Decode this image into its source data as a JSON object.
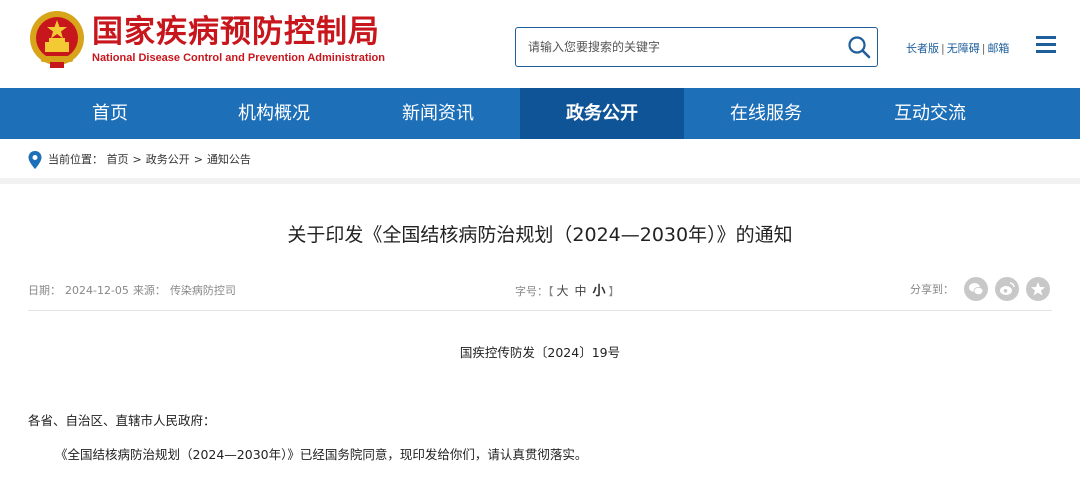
{
  "header": {
    "site_title": "国家疾病预防控制局",
    "site_subtitle": "National Disease Control and Prevention Administration",
    "search_placeholder": "请输入您要搜索的关键字",
    "links": [
      "长者版",
      "无障碍",
      "邮箱"
    ]
  },
  "nav": {
    "items": [
      "首页",
      "机构概况",
      "新闻资讯",
      "政务公开",
      "在线服务",
      "互动交流"
    ],
    "active": "政务公开"
  },
  "breadcrumb": {
    "label": "当前位置：",
    "items": [
      "首页",
      "政务公开",
      "通知公告"
    ]
  },
  "article": {
    "title": "关于印发《全国结核病防治规划（2024—2030年）》的通知",
    "date_label": "日期：",
    "date": "2024-12-05",
    "source_label": "来源：",
    "source": "传染病防控司",
    "font_size_label": "字号：",
    "font_sizes": [
      "大",
      "中",
      "小"
    ],
    "font_open": "【",
    "font_close": "】",
    "share_label": "分享到：",
    "doc_number": "国疾控传防发〔2024〕19号",
    "salutation": "各省、自治区、直辖市人民政府：",
    "body": "《全国结核病防治规划（2024—2030年）》已经国务院同意，现印发给你们，请认真贯彻落实。"
  },
  "colors": {
    "brand_red": "#c8161d",
    "nav_blue": "#1d6fb8",
    "nav_active": "#0f5496"
  },
  "icons": [
    "national-emblem-icon",
    "search-icon",
    "menu-icon",
    "location-pin-icon",
    "wechat-icon",
    "weibo-icon",
    "qzone-icon"
  ]
}
